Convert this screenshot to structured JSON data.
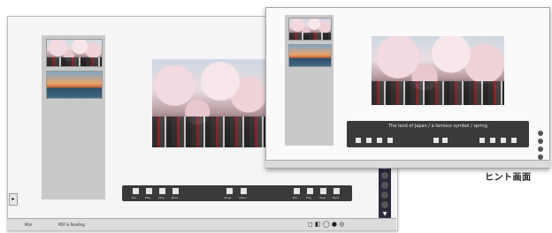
{
  "back_window": {
    "toolbar_left_labels": [
      "Rec",
      "Play",
      "Stop",
      "Next"
    ],
    "toolbar_mid_labels": [
      "Large",
      "Clear"
    ],
    "toolbar_right_labels": [
      "Rec",
      "Play",
      "Stop",
      "Next"
    ],
    "taskbar_app_label": "PDF & Reading",
    "taskbar_left_label": "Mini"
  },
  "front_window": {
    "caption": "The land of Japan / a famous symbol / spring"
  },
  "hint_label": "ヒント画面"
}
